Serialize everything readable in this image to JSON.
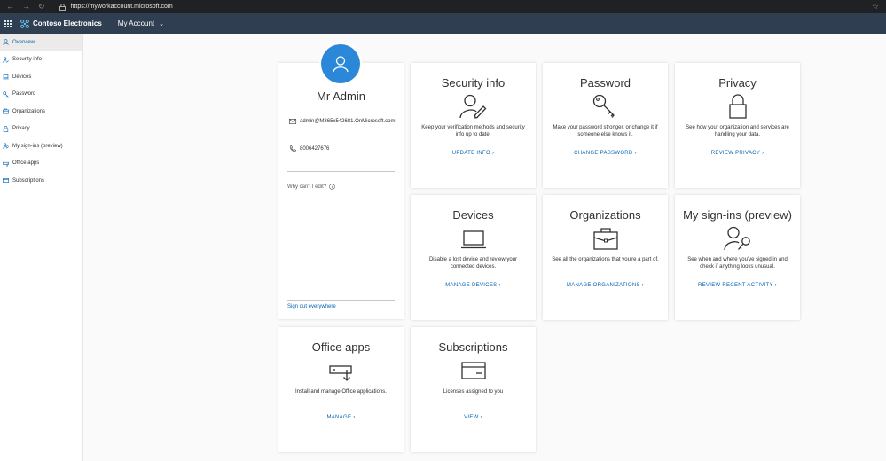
{
  "browser": {
    "url": "https://myworkaccount.microsoft.com"
  },
  "header": {
    "brand": "Contoso Electronics",
    "account_menu": "My Account"
  },
  "sidebar": {
    "items": [
      {
        "label": "Overview",
        "icon": "person-icon"
      },
      {
        "label": "Security info",
        "icon": "security-icon"
      },
      {
        "label": "Devices",
        "icon": "laptop-icon"
      },
      {
        "label": "Password",
        "icon": "key-icon"
      },
      {
        "label": "Organizations",
        "icon": "briefcase-icon"
      },
      {
        "label": "Privacy",
        "icon": "lock-icon"
      },
      {
        "label": "My sign-ins (preview)",
        "icon": "signins-icon"
      },
      {
        "label": "Office apps",
        "icon": "office-apps-icon"
      },
      {
        "label": "Subscriptions",
        "icon": "card-icon"
      }
    ]
  },
  "profile": {
    "name": "Mr Admin",
    "email": "admin@M365x542681.OnMicrosoft.com",
    "phone": "8006427676",
    "why_cant_edit": "Why can't I edit?",
    "sign_out": "Sign out everywhere"
  },
  "cards": {
    "security": {
      "title": "Security info",
      "desc": "Keep your verification methods and security info up to date.",
      "link": "UPDATE INFO"
    },
    "password": {
      "title": "Password",
      "desc": "Make your password stronger, or change it if someone else knows it.",
      "link": "CHANGE PASSWORD"
    },
    "privacy": {
      "title": "Privacy",
      "desc": "See how your organization and services are handling your data.",
      "link": "REVIEW PRIVACY"
    },
    "devices": {
      "title": "Devices",
      "desc": "Disable a lost device and review your connected devices.",
      "link": "MANAGE DEVICES"
    },
    "organizations": {
      "title": "Organizations",
      "desc": "See all the organizations that you're a part of.",
      "link": "MANAGE ORGANIZATIONS"
    },
    "signins": {
      "title": "My sign-ins (preview)",
      "desc": "See when and where you've signed in and check if anything looks unusual.",
      "link": "REVIEW RECENT ACTIVITY"
    },
    "office": {
      "title": "Office apps",
      "desc": "Install and manage Office applications.",
      "link": "MANAGE"
    },
    "subscriptions": {
      "title": "Subscriptions",
      "desc": "Licenses assigned to you",
      "link": "VIEW"
    }
  },
  "colors": {
    "header_bg": "#2f3e50",
    "accent": "#0063b1",
    "avatar": "#2b88d8"
  }
}
